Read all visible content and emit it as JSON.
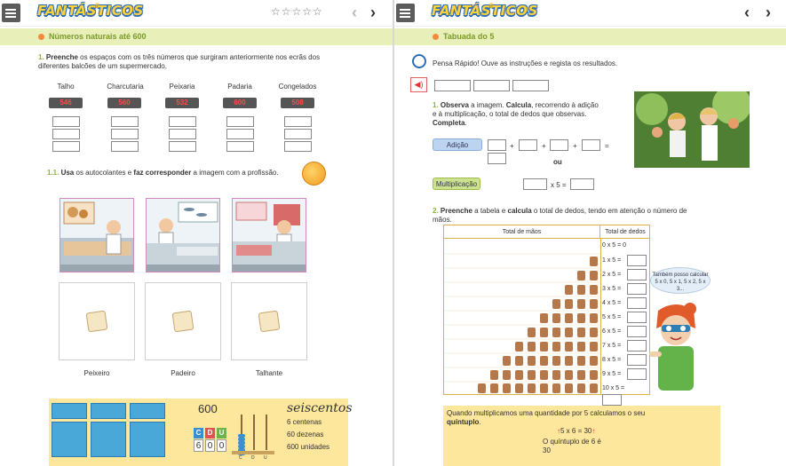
{
  "app": {
    "logo_text": "FANTÁSTICOS",
    "stars": "☆☆☆☆☆"
  },
  "icons": {
    "menu": "hamburger-menu-icon",
    "prev": "chevron-left-icon",
    "next": "chevron-right-icon",
    "stopwatch": "stopwatch-icon",
    "audio": "speaker-icon",
    "sticker": "sticker-icon",
    "globe": "globe-badge-icon"
  },
  "colors": {
    "chapter_bg": "#e9efb9",
    "chapter_text": "#7b9a2a",
    "accent_orange": "#f08a3c",
    "highlight_yellow": "#fde79c"
  },
  "left": {
    "chapter_title": "Números naturais até 600",
    "ex1": {
      "number": "1.",
      "bold": "Preenche",
      "text_line1": " os espaços com os três números que surgiram anteriormente nos ecrãs dos",
      "text_line2": "diferentes balcões de um supermercado."
    },
    "columns": [
      {
        "label": "Talho",
        "value": "546"
      },
      {
        "label": "Charcutaria",
        "value": "560"
      },
      {
        "label": "Peixaria",
        "value": "532"
      },
      {
        "label": "Padaria",
        "value": "600"
      },
      {
        "label": "Congelados",
        "value": "508"
      }
    ],
    "ex11": {
      "number": "1.1.",
      "bold1": "Usa",
      "text1": " os autocolantes e ",
      "bold2": "faz corresponder",
      "text2": " a imagem com a profissão."
    },
    "professions": [
      "Peixeiro",
      "Padeiro",
      "Talhante"
    ],
    "info": {
      "number": "600",
      "word": "seiscentos",
      "line1": "6 centenas",
      "line2": "60 dezenas",
      "line3": "600 unidades",
      "cdu": [
        "C",
        "D",
        "U"
      ],
      "digits": [
        "6",
        "0",
        "0"
      ],
      "abacus_labels": [
        "C",
        "D",
        "U"
      ]
    }
  },
  "right": {
    "chapter_title": "Tabuada do 5",
    "pensa_rapido": "Pensa Rápido! Ouve as instruções e regista os resultados.",
    "ex1": {
      "number": "1.",
      "bold1": "Observa",
      "text1": " a imagem. ",
      "bold2": "Calcula",
      "text2": ", recorrendo à adição",
      "line2": "e à multiplicação, o total de dedos que observas.",
      "bold3": "Completa",
      "dot": "."
    },
    "addition_label": "Adição",
    "plus": "+",
    "equals": "=",
    "ou": "ou",
    "multiplication_label": "Multiplicação",
    "times_five": "x 5 =",
    "ex2": {
      "number": "2.",
      "bold1": "Preenche",
      "text1": " a tabela e ",
      "bold2": "calcula",
      "text2": " o total de dedos, tendo em atenção o número de",
      "line2": "mãos."
    },
    "table": {
      "header_hands": "Total de mãos",
      "header_fingers": "Total de dedos",
      "rows": [
        "0 x 5 = 0",
        "1 x 5 =",
        "2 x 5 =",
        "3 x 5 =",
        "4 x 5 =",
        "5 x 5 =",
        "6 x 5 =",
        "7 x 5 =",
        "8 x 5 =",
        "9 x 5 =",
        "10 x 5 ="
      ]
    },
    "speech": "Também posso calcular 5 x 0, 5 x 1, 5 x 2, 5 x 3...",
    "quintuplo": {
      "line1": "Quando multiplicamos uma quantidade por 5 calculamos o seu",
      "bold": "quíntuplo",
      "dot": ".",
      "example": "5 x 6 = 30",
      "caption1": "O quíntuplo de 6 é",
      "caption2": "30"
    }
  }
}
